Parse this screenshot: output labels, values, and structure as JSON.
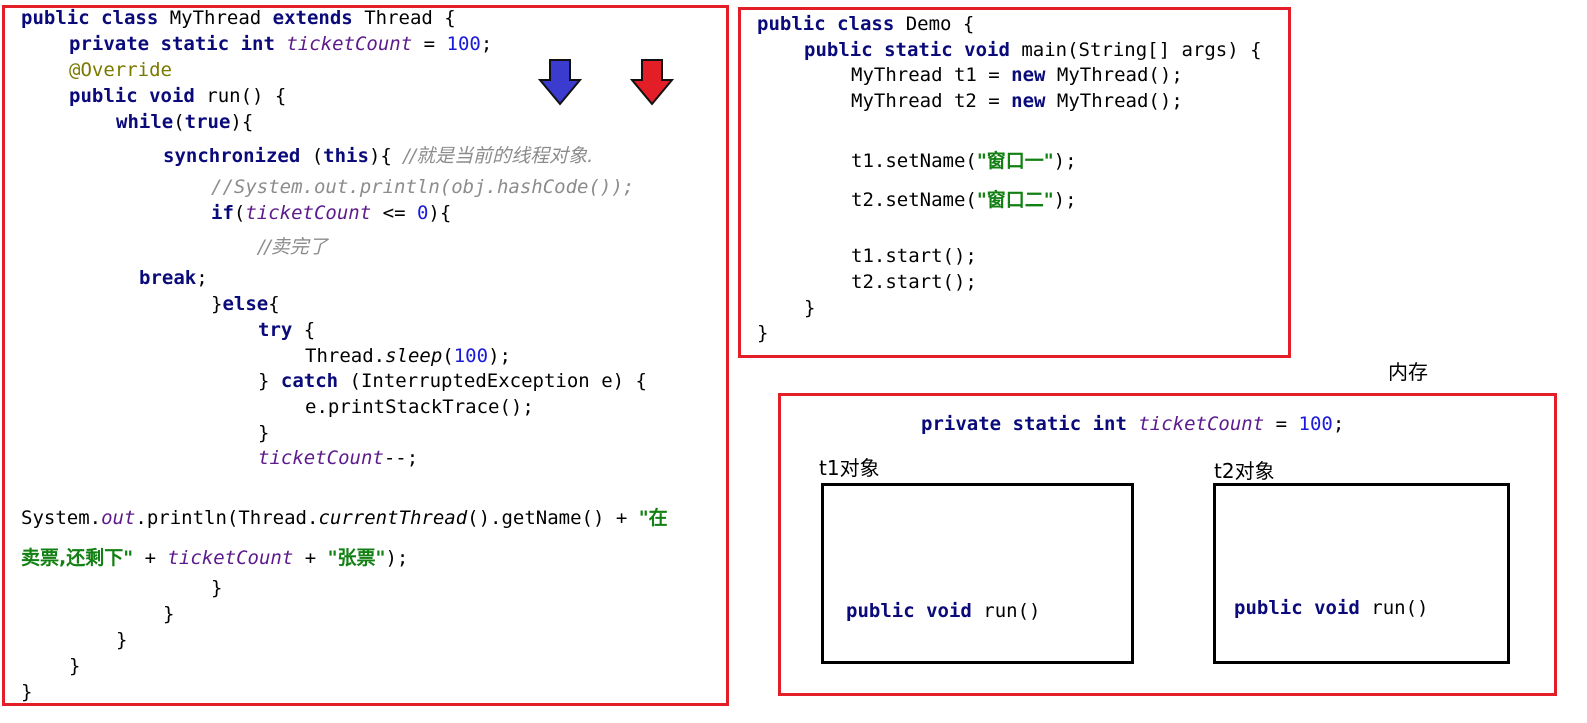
{
  "mythread_code": {
    "l1": {
      "kw": "public class",
      "a": " MyThread ",
      "kw2": "extends",
      "b": " Thread {"
    },
    "l2": {
      "kw": "private static int",
      "fld": "ticketCount",
      "eq": " = ",
      "num": "100",
      "end": ";"
    },
    "l3": "@Override",
    "l4": {
      "kw": "public void",
      "a": " run() {"
    },
    "l5": {
      "kw": "while",
      "a": "(",
      "kw2": "true",
      "b": "){"
    },
    "l6": {
      "kw": "synchronized",
      "a": " (",
      "kw2": "this",
      "b": "){ ",
      "cmt": "//就是当前的线程对象."
    },
    "l7": "//System.out.println(obj.hashCode());",
    "l8": {
      "kw": "if",
      "a": "(",
      "fld": "ticketCount",
      "b": " <= ",
      "num": "0",
      "c": "){"
    },
    "l9": "//卖完了",
    "l10": {
      "kw": "break",
      "a": ";"
    },
    "l11": {
      "a": "}",
      "kw": "else",
      "b": "{"
    },
    "l12": {
      "kw": "try",
      "a": " {"
    },
    "l13": {
      "a": "Thread.",
      "it": "sleep",
      "b": "(",
      "num": "100",
      "c": ");"
    },
    "l14": {
      "a": "} ",
      "kw": "catch",
      "b": " (InterruptedException e) {"
    },
    "l15": "e.printStackTrace();",
    "l16": "}",
    "l17": {
      "fld": "ticketCount",
      "a": "--;"
    },
    "l18": {
      "a": "System.",
      "fld": "out",
      "b": ".println(Thread.",
      "it": "currentThread",
      "c": "().getName() + ",
      "str": "\"在"
    },
    "l19": {
      "str": "卖票,还剩下\"",
      "a": " + ",
      "fld": "ticketCount",
      "b": " + ",
      "str2": "\"张票\"",
      "c": ");"
    },
    "l20": "}",
    "l21": "}",
    "l22": "}",
    "l23": "}",
    "l24": "}"
  },
  "demo_code": {
    "l1": {
      "kw": "public class",
      "a": " Demo {"
    },
    "l2": {
      "kw": "public static void",
      "a": " main(String[] args) {"
    },
    "l3": {
      "a": "MyThread t1 = ",
      "kw": "new",
      "b": " MyThread();"
    },
    "l4": {
      "a": "MyThread t2 = ",
      "kw": "new",
      "b": " MyThread();"
    },
    "l5": {
      "a": "t1.setName(",
      "str": "\"窗口一\"",
      "b": ");"
    },
    "l6": {
      "a": "t2.setName(",
      "str": "\"窗口二\"",
      "b": ");"
    },
    "l7": "t1.start();",
    "l8": "t2.start();",
    "l9": "}",
    "l10": "}"
  },
  "memory": {
    "title": "内存",
    "static_line": {
      "kw": "private static int",
      "fld": "ticketCount",
      "eq": " = ",
      "num": "100",
      "end": ";"
    },
    "t1_label": "t1对象",
    "t2_label": "t2对象",
    "run_kw": "public void",
    "run_name": " run()"
  },
  "arrows": [
    {
      "name": "blue-arrow",
      "color": "#3b3bcf"
    },
    {
      "name": "red-arrow",
      "color": "#e41e26"
    }
  ],
  "colors": {
    "border": "#e41e26",
    "keyword": "#0a0a7a",
    "number": "#1a1adb",
    "field": "#5c1a8c",
    "string": "#128012",
    "comment": "#8c8c8c"
  }
}
